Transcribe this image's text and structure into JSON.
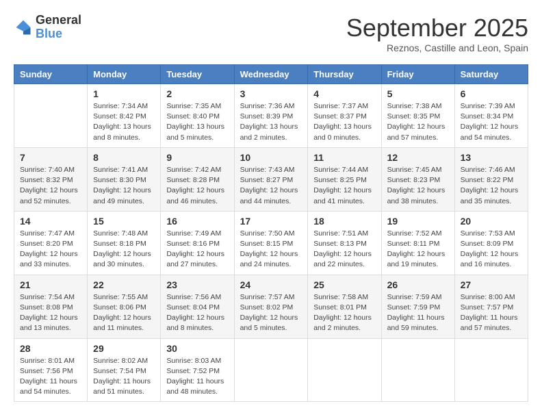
{
  "header": {
    "logo_general": "General",
    "logo_blue": "Blue",
    "month_title": "September 2025",
    "subtitle": "Reznos, Castille and Leon, Spain"
  },
  "days_of_week": [
    "Sunday",
    "Monday",
    "Tuesday",
    "Wednesday",
    "Thursday",
    "Friday",
    "Saturday"
  ],
  "weeks": [
    [
      {
        "day": "",
        "info": ""
      },
      {
        "day": "1",
        "info": "Sunrise: 7:34 AM\nSunset: 8:42 PM\nDaylight: 13 hours\nand 8 minutes."
      },
      {
        "day": "2",
        "info": "Sunrise: 7:35 AM\nSunset: 8:40 PM\nDaylight: 13 hours\nand 5 minutes."
      },
      {
        "day": "3",
        "info": "Sunrise: 7:36 AM\nSunset: 8:39 PM\nDaylight: 13 hours\nand 2 minutes."
      },
      {
        "day": "4",
        "info": "Sunrise: 7:37 AM\nSunset: 8:37 PM\nDaylight: 13 hours\nand 0 minutes."
      },
      {
        "day": "5",
        "info": "Sunrise: 7:38 AM\nSunset: 8:35 PM\nDaylight: 12 hours\nand 57 minutes."
      },
      {
        "day": "6",
        "info": "Sunrise: 7:39 AM\nSunset: 8:34 PM\nDaylight: 12 hours\nand 54 minutes."
      }
    ],
    [
      {
        "day": "7",
        "info": "Sunrise: 7:40 AM\nSunset: 8:32 PM\nDaylight: 12 hours\nand 52 minutes."
      },
      {
        "day": "8",
        "info": "Sunrise: 7:41 AM\nSunset: 8:30 PM\nDaylight: 12 hours\nand 49 minutes."
      },
      {
        "day": "9",
        "info": "Sunrise: 7:42 AM\nSunset: 8:28 PM\nDaylight: 12 hours\nand 46 minutes."
      },
      {
        "day": "10",
        "info": "Sunrise: 7:43 AM\nSunset: 8:27 PM\nDaylight: 12 hours\nand 44 minutes."
      },
      {
        "day": "11",
        "info": "Sunrise: 7:44 AM\nSunset: 8:25 PM\nDaylight: 12 hours\nand 41 minutes."
      },
      {
        "day": "12",
        "info": "Sunrise: 7:45 AM\nSunset: 8:23 PM\nDaylight: 12 hours\nand 38 minutes."
      },
      {
        "day": "13",
        "info": "Sunrise: 7:46 AM\nSunset: 8:22 PM\nDaylight: 12 hours\nand 35 minutes."
      }
    ],
    [
      {
        "day": "14",
        "info": "Sunrise: 7:47 AM\nSunset: 8:20 PM\nDaylight: 12 hours\nand 33 minutes."
      },
      {
        "day": "15",
        "info": "Sunrise: 7:48 AM\nSunset: 8:18 PM\nDaylight: 12 hours\nand 30 minutes."
      },
      {
        "day": "16",
        "info": "Sunrise: 7:49 AM\nSunset: 8:16 PM\nDaylight: 12 hours\nand 27 minutes."
      },
      {
        "day": "17",
        "info": "Sunrise: 7:50 AM\nSunset: 8:15 PM\nDaylight: 12 hours\nand 24 minutes."
      },
      {
        "day": "18",
        "info": "Sunrise: 7:51 AM\nSunset: 8:13 PM\nDaylight: 12 hours\nand 22 minutes."
      },
      {
        "day": "19",
        "info": "Sunrise: 7:52 AM\nSunset: 8:11 PM\nDaylight: 12 hours\nand 19 minutes."
      },
      {
        "day": "20",
        "info": "Sunrise: 7:53 AM\nSunset: 8:09 PM\nDaylight: 12 hours\nand 16 minutes."
      }
    ],
    [
      {
        "day": "21",
        "info": "Sunrise: 7:54 AM\nSunset: 8:08 PM\nDaylight: 12 hours\nand 13 minutes."
      },
      {
        "day": "22",
        "info": "Sunrise: 7:55 AM\nSunset: 8:06 PM\nDaylight: 12 hours\nand 11 minutes."
      },
      {
        "day": "23",
        "info": "Sunrise: 7:56 AM\nSunset: 8:04 PM\nDaylight: 12 hours\nand 8 minutes."
      },
      {
        "day": "24",
        "info": "Sunrise: 7:57 AM\nSunset: 8:02 PM\nDaylight: 12 hours\nand 5 minutes."
      },
      {
        "day": "25",
        "info": "Sunrise: 7:58 AM\nSunset: 8:01 PM\nDaylight: 12 hours\nand 2 minutes."
      },
      {
        "day": "26",
        "info": "Sunrise: 7:59 AM\nSunset: 7:59 PM\nDaylight: 11 hours\nand 59 minutes."
      },
      {
        "day": "27",
        "info": "Sunrise: 8:00 AM\nSunset: 7:57 PM\nDaylight: 11 hours\nand 57 minutes."
      }
    ],
    [
      {
        "day": "28",
        "info": "Sunrise: 8:01 AM\nSunset: 7:56 PM\nDaylight: 11 hours\nand 54 minutes."
      },
      {
        "day": "29",
        "info": "Sunrise: 8:02 AM\nSunset: 7:54 PM\nDaylight: 11 hours\nand 51 minutes."
      },
      {
        "day": "30",
        "info": "Sunrise: 8:03 AM\nSunset: 7:52 PM\nDaylight: 11 hours\nand 48 minutes."
      },
      {
        "day": "",
        "info": ""
      },
      {
        "day": "",
        "info": ""
      },
      {
        "day": "",
        "info": ""
      },
      {
        "day": "",
        "info": ""
      }
    ]
  ]
}
